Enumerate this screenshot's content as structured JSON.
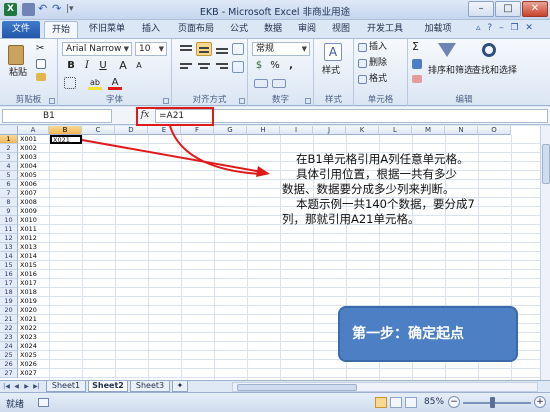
{
  "window": {
    "title": "EKB - Microsoft Excel 非商业用途",
    "app_icon": "X",
    "minimize": "–",
    "maximize": "□",
    "close": "✕"
  },
  "quick_access": {
    "undo": "↶",
    "redo": "↷",
    "customize": "|▾"
  },
  "tabs": [
    {
      "label": "文件",
      "id": "file"
    },
    {
      "label": "开始",
      "id": "home",
      "active": true
    },
    {
      "label": "怀旧菜单",
      "id": "classic"
    },
    {
      "label": "插入",
      "id": "insert"
    },
    {
      "label": "页面布局",
      "id": "layout"
    },
    {
      "label": "公式",
      "id": "formulas"
    },
    {
      "label": "数据",
      "id": "data"
    },
    {
      "label": "审阅",
      "id": "review"
    },
    {
      "label": "视图",
      "id": "view"
    },
    {
      "label": "开发工具",
      "id": "developer"
    },
    {
      "label": "加载项",
      "id": "addins"
    }
  ],
  "ribbon": {
    "clipboard": {
      "label": "剪贴板",
      "paste": "粘贴"
    },
    "font": {
      "label": "字体",
      "name": "Arial Narrow",
      "size": "10",
      "bold": "B",
      "italic": "I",
      "underline": "U",
      "grow": "A",
      "shrink": "A",
      "font_color": "A",
      "highlight": "ab"
    },
    "alignment": {
      "label": "对齐方式"
    },
    "number": {
      "label": "数字",
      "format": "常规",
      "percent": "%",
      "comma": ",",
      "currency": "$"
    },
    "styles": {
      "label": "样式",
      "button": "样式"
    },
    "cells": {
      "label": "单元格",
      "insert": "插入",
      "delete": "删除",
      "format": "格式"
    },
    "editing": {
      "label": "编辑",
      "sum": "Σ",
      "sort_filter": "排序和筛选",
      "find_select": "查找和选择"
    }
  },
  "formula_bar": {
    "name_box": "B1",
    "fx": "fx",
    "formula": "=A21"
  },
  "grid": {
    "columns": [
      "A",
      "B",
      "C",
      "D",
      "E",
      "F",
      "G",
      "H",
      "I",
      "J",
      "K",
      "L",
      "M",
      "N",
      "O"
    ],
    "rows": [
      "1",
      "2",
      "3",
      "4",
      "5",
      "6",
      "7",
      "8",
      "9",
      "10",
      "11",
      "12",
      "13",
      "14",
      "15",
      "16",
      "17",
      "18",
      "19",
      "20",
      "21",
      "22",
      "23",
      "24",
      "25",
      "26",
      "27"
    ],
    "column_a": [
      "X001",
      "X002",
      "X003",
      "X004",
      "X005",
      "X006",
      "X007",
      "X008",
      "X009",
      "X010",
      "X011",
      "X012",
      "X013",
      "X014",
      "X015",
      "X016",
      "X017",
      "X018",
      "X019",
      "X020",
      "X021",
      "X022",
      "X023",
      "X024",
      "X025",
      "X026",
      "X027"
    ],
    "b1_value": "X021",
    "selected_cell": "B1"
  },
  "annotation": {
    "lines": [
      "在B1单元格引用A列任意单元格。",
      "具体引用位置，根据一共有多少",
      "数据、数据要分成多少列来判断。",
      "本题示例一共140个数据，要分成7",
      "列，那就引用A21单元格。"
    ],
    "step": "第一步：确定起点"
  },
  "sheets": [
    {
      "label": "Sheet1"
    },
    {
      "label": "Sheet2",
      "active": true
    },
    {
      "label": "Sheet3"
    }
  ],
  "status": {
    "ready": "就绪",
    "zoom": "85%",
    "zoom_minus": "−",
    "zoom_plus": "+"
  },
  "colors": {
    "arrow": "#e01a1a",
    "step_box": "#4d7fc4",
    "file_tab": "#2b62b8"
  }
}
